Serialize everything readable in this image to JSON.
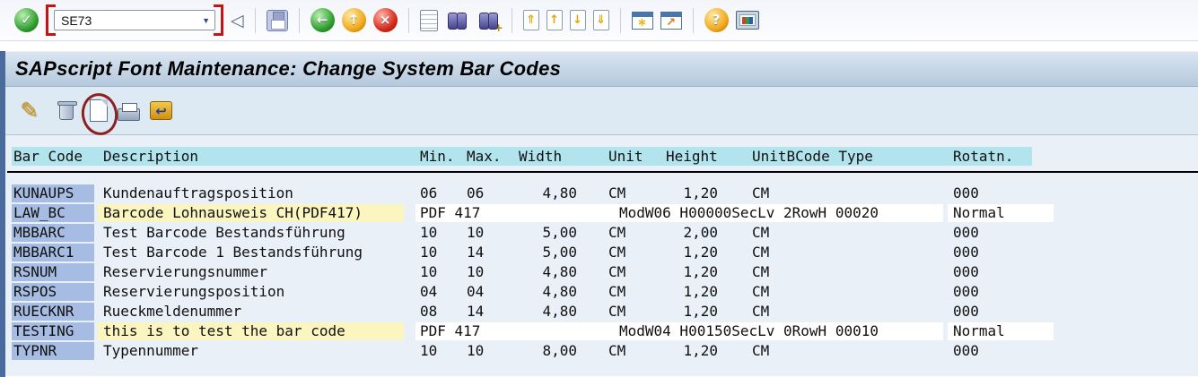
{
  "toolbar": {
    "enter_icon": {
      "name": "enter-icon",
      "glyph": "✓"
    },
    "command_value": "SE73",
    "dropdown_glyph": "▼",
    "buttons": [
      {
        "name": "collapse-command-field-icon",
        "type": "collapse",
        "glyph": "◁"
      },
      {
        "type": "sep"
      },
      {
        "name": "save-icon",
        "type": "disk"
      },
      {
        "type": "sep"
      },
      {
        "name": "back-icon",
        "type": "sphere green",
        "glyph": "←"
      },
      {
        "name": "exit-icon",
        "type": "sphere amber",
        "glyph": "↑"
      },
      {
        "name": "cancel-icon",
        "type": "sphere red",
        "glyph": "×"
      },
      {
        "type": "sep"
      },
      {
        "name": "print-icon",
        "type": "printpage"
      },
      {
        "name": "find-icon",
        "type": "binoc"
      },
      {
        "name": "find-next-icon",
        "type": "binoc plus",
        "glyph": "+"
      },
      {
        "type": "sep"
      },
      {
        "name": "first-page-icon",
        "type": "pagenav",
        "glyph": "⇑"
      },
      {
        "name": "previous-page-icon",
        "type": "pagenav",
        "glyph": "↑"
      },
      {
        "name": "next-page-icon",
        "type": "pagenav",
        "glyph": "↓"
      },
      {
        "name": "last-page-icon",
        "type": "pagenav",
        "glyph": "⇓"
      },
      {
        "type": "sep"
      },
      {
        "name": "new-session-icon",
        "type": "winstar",
        "glyph": "∗"
      },
      {
        "name": "create-shortcut-icon",
        "type": "winarrow",
        "glyph": "↗"
      },
      {
        "type": "sep"
      },
      {
        "name": "help-icon",
        "type": "sphere amber",
        "glyph": "?"
      },
      {
        "name": "customize-layout-icon",
        "type": "monitor"
      }
    ]
  },
  "title_bar": {
    "title": "SAPscript Font Maintenance: Change System Bar Codes"
  },
  "app_toolbar": {
    "icons": [
      {
        "name": "edit-icon",
        "type": "pencil",
        "glyph": "✎"
      },
      {
        "name": "delete-icon",
        "type": "trash"
      },
      {
        "name": "create-icon",
        "type": "newpage",
        "annotated": true
      },
      {
        "name": "print-icon",
        "type": "printer"
      },
      {
        "name": "transport-icon",
        "type": "goldarrow",
        "glyph": "↩"
      }
    ]
  },
  "table": {
    "headers": {
      "bar_code": "Bar Code",
      "description": "Description",
      "min": "Min.",
      "max": "Max.",
      "width": "Width",
      "unit": "Unit",
      "height": "Height",
      "unit_bcode_type": "UnitBCode Type",
      "rotation": "Rotatn."
    },
    "rows": [
      {
        "barcode": "KUNAUPS",
        "description": "Kundenauftragsposition",
        "desc_highlight": false,
        "pdf": false,
        "min": "06",
        "max": "06",
        "width": "4,80",
        "unit": "CM",
        "height": "1,20",
        "unit2": "CM",
        "rotation": "000"
      },
      {
        "barcode": "LAW_BC",
        "description": "Barcode Lohnausweis CH(PDF417)",
        "desc_highlight": true,
        "pdf": true,
        "pdf_label": "PDF 417",
        "params": "ModW06 H00000SecLv 2RowH 00020",
        "rotation": "Normal"
      },
      {
        "barcode": "MBBARC",
        "description": "Test Barcode Bestandsführung",
        "desc_highlight": false,
        "pdf": false,
        "min": "10",
        "max": "10",
        "width": "5,00",
        "unit": "CM",
        "height": "2,00",
        "unit2": "CM",
        "rotation": "000"
      },
      {
        "barcode": "MBBARC1",
        "description": "Test Barcode 1 Bestandsführung",
        "desc_highlight": false,
        "pdf": false,
        "min": "10",
        "max": "14",
        "width": "5,00",
        "unit": "CM",
        "height": "1,20",
        "unit2": "CM",
        "rotation": "000"
      },
      {
        "barcode": "RSNUM",
        "description": "Reservierungsnummer",
        "desc_highlight": false,
        "pdf": false,
        "min": "10",
        "max": "10",
        "width": "4,80",
        "unit": "CM",
        "height": "1,20",
        "unit2": "CM",
        "rotation": "000"
      },
      {
        "barcode": "RSPOS",
        "description": "Reservierungsposition",
        "desc_highlight": false,
        "pdf": false,
        "min": "04",
        "max": "04",
        "width": "4,80",
        "unit": "CM",
        "height": "1,20",
        "unit2": "CM",
        "rotation": "000"
      },
      {
        "barcode": "RUECKNR",
        "description": "Rueckmeldenummer",
        "desc_highlight": false,
        "pdf": false,
        "min": "08",
        "max": "14",
        "width": "4,80",
        "unit": "CM",
        "height": "1,20",
        "unit2": "CM",
        "rotation": "000"
      },
      {
        "barcode": "TESTING",
        "description": "this is to test the bar code",
        "desc_highlight": true,
        "pdf": true,
        "pdf_label": "PDF 417",
        "params": "ModW04 H00150SecLv 0RowH 00010",
        "rotation": "Normal"
      },
      {
        "barcode": "TYPNR",
        "description": "Typennummer",
        "desc_highlight": false,
        "pdf": false,
        "min": "10",
        "max": "10",
        "width": "8,00",
        "unit": "CM",
        "height": "1,20",
        "unit2": "CM",
        "rotation": "000"
      }
    ]
  },
  "colors": {
    "annotation_red": "#c41414",
    "circle_red": "#8e2020",
    "header_highlight": "#b2e4ee",
    "barcode_cell": "#a6bce2",
    "highlight_yellow": "#fbf6c0",
    "field_white": "#ffffff",
    "titlebar_top": "#d9e5f1",
    "titlebar_bottom": "#b5c9dd",
    "app_toolbar_bg": "#dde9f3",
    "content_bg": "#e9f0f8",
    "left_strip": "#4a6b9c"
  }
}
